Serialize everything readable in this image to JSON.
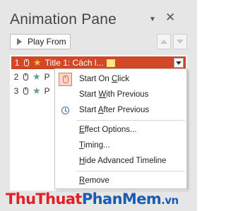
{
  "pane": {
    "title": "Animation Pane",
    "dropdown_glyph": "▼",
    "close_glyph": "✕"
  },
  "toolbar": {
    "play_label": "Play From",
    "move_up_icon": "triangle-up",
    "move_down_icon": "triangle-down"
  },
  "list": {
    "items": [
      {
        "number": "1",
        "label": "Title 1: Cách l...",
        "selected": true,
        "star_color": "#f5c342"
      },
      {
        "number": "2",
        "label": "P",
        "selected": false,
        "star_color": "#5aa08a"
      },
      {
        "number": "3",
        "label": "P",
        "selected": false,
        "star_color": "#5aa08a"
      }
    ]
  },
  "menu": {
    "items": [
      {
        "pre": "Start On ",
        "u": "C",
        "post": "lick",
        "icon": "mouse-icon"
      },
      {
        "pre": "Start ",
        "u": "W",
        "post": "ith Previous",
        "icon": ""
      },
      {
        "pre": "Start ",
        "u": "A",
        "post": "fter Previous",
        "icon": "clock-icon"
      },
      {
        "pre": "",
        "u": "E",
        "post": "ffect Options...",
        "icon": ""
      },
      {
        "pre": "",
        "u": "T",
        "post": "iming...",
        "icon": ""
      },
      {
        "pre": "",
        "u": "H",
        "post": "ide Advanced Timeline",
        "icon": ""
      },
      {
        "pre": "",
        "u": "R",
        "post": "emove",
        "icon": ""
      }
    ]
  },
  "watermark": {
    "part1": "ThuThuat",
    "part2": "PhanMem",
    "part3": ".vn"
  },
  "colors": {
    "selected_row": "#d24726",
    "accent_blue": "#1c5bb4",
    "accent_red": "#e21f26"
  }
}
